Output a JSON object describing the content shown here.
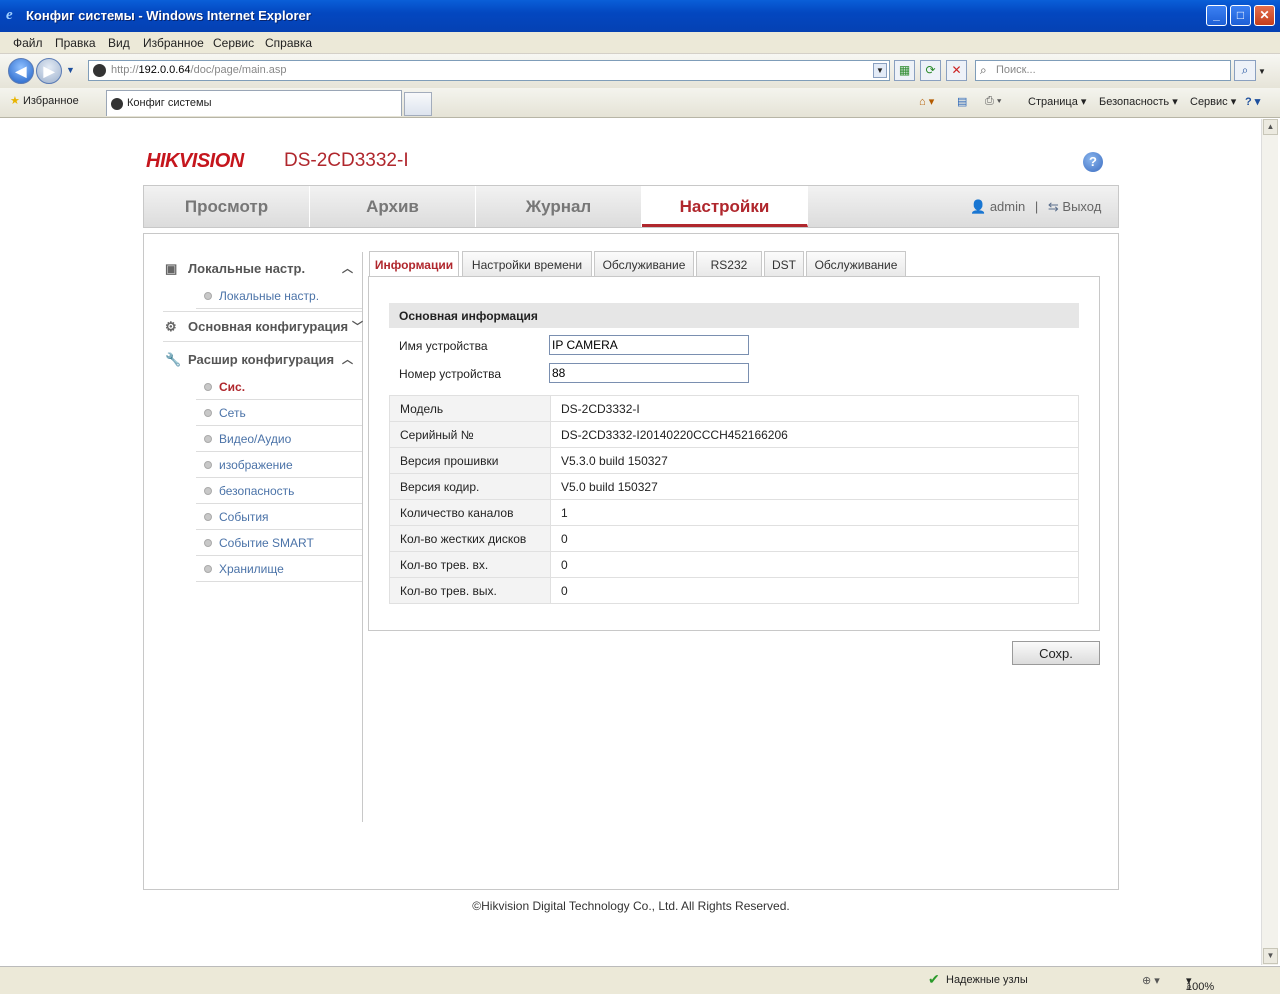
{
  "window": {
    "title": "Конфиг системы - Windows Internet Explorer"
  },
  "menu": [
    "Файл",
    "Правка",
    "Вид",
    "Избранное",
    "Сервис",
    "Справка"
  ],
  "address": {
    "url_prefix": "http://",
    "url_host": "192.0.0.64",
    "url_path": "/doc/page/main.asp",
    "search_placeholder": "Поиск..."
  },
  "favorites": {
    "label": "Избранное",
    "tab_title": "Конфиг системы"
  },
  "toolbar": {
    "page": "Страница",
    "security": "Безопасность",
    "service": "Сервис"
  },
  "status": {
    "zone": "Надежные узлы",
    "zoom": "100%"
  },
  "header": {
    "brand": "HIKVISION",
    "model": "DS-2CD3332-I",
    "help": "?"
  },
  "nav": {
    "tabs": [
      "Просмотр",
      "Архив",
      "Журнал",
      "Настройки"
    ],
    "active": "Настройки",
    "user": "admin",
    "separator": "|",
    "logout": "Выход"
  },
  "sidebar": {
    "local": {
      "title": "Локальные настр.",
      "items": [
        "Локальные настр."
      ]
    },
    "basic": {
      "title": "Основная конфигурация"
    },
    "advanced": {
      "title": "Расшир конфигурация",
      "items": [
        "Сис.",
        "Сеть",
        "Видео/Аудио",
        "изображение",
        "безопасность",
        "События",
        "Событие SMART",
        "Хранилище"
      ]
    }
  },
  "subtabs": [
    "Информации",
    "Настройки времени",
    "Обслуживание",
    "RS232",
    "DST",
    "Обслуживание"
  ],
  "form": {
    "section_title": "Основная информация",
    "device_name_label": "Имя устройства",
    "device_name_value": "IP CAMERA",
    "device_number_label": "Номер устройства",
    "device_number_value": "88"
  },
  "info_rows": [
    {
      "label": "Модель",
      "value": "DS-2CD3332-I"
    },
    {
      "label": "Серийный №",
      "value": "DS-2CD3332-I20140220CCCH452166206"
    },
    {
      "label": "Версия прошивки",
      "value": "V5.3.0 build 150327"
    },
    {
      "label": "Версия кодир.",
      "value": "V5.0 build 150327"
    },
    {
      "label": "Количество каналов",
      "value": "1"
    },
    {
      "label": "Кол-во жестких дисков",
      "value": "0"
    },
    {
      "label": "Кол-во трев. вх.",
      "value": "0"
    },
    {
      "label": "Кол-во трев. вых.",
      "value": "0"
    }
  ],
  "save_label": "Сохр.",
  "footer": "©Hikvision Digital Technology Co., Ltd. All Rights Reserved.",
  "colors": {
    "accent": "#b0272d",
    "link": "#4b73a8",
    "titlebar": "#0347c0"
  }
}
